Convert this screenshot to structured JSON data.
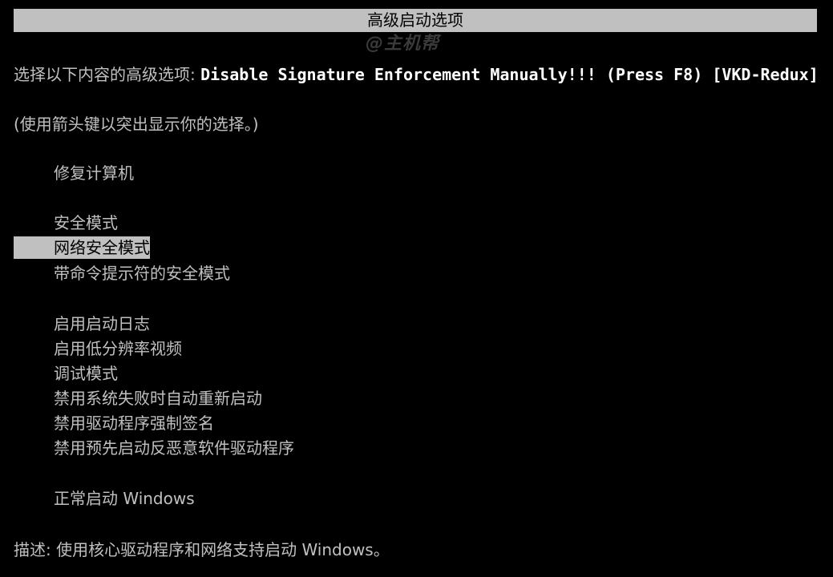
{
  "title": "高级启动选项",
  "watermark": "@主机帮",
  "prompt": {
    "label": "选择以下内容的高级选项: ",
    "os_name": "Disable Signature Enforcement Manually!!! (Press F8) [VKD-Redux]"
  },
  "hint": "(使用箭头键以突出显示你的选择。)",
  "menu": [
    {
      "label": "修复计算机",
      "selected": false
    },
    {
      "label": "安全模式",
      "selected": false
    },
    {
      "label": "网络安全模式",
      "selected": true
    },
    {
      "label": "带命令提示符的安全模式",
      "selected": false
    },
    {
      "label": "启用启动日志",
      "selected": false
    },
    {
      "label": "启用低分辨率视频",
      "selected": false
    },
    {
      "label": "调试模式",
      "selected": false
    },
    {
      "label": "禁用系统失败时自动重新启动",
      "selected": false
    },
    {
      "label": "禁用驱动程序强制签名",
      "selected": false
    },
    {
      "label": "禁用预先启动反恶意软件驱动程序",
      "selected": false
    },
    {
      "label": "正常启动 Windows",
      "selected": false
    }
  ],
  "description": "描述: 使用核心驱动程序和网络支持启动 Windows。",
  "colors": {
    "background": "#000000",
    "text": "#c0c0c0",
    "highlight": "#c0c0c0",
    "highlight_text": "#000000"
  }
}
